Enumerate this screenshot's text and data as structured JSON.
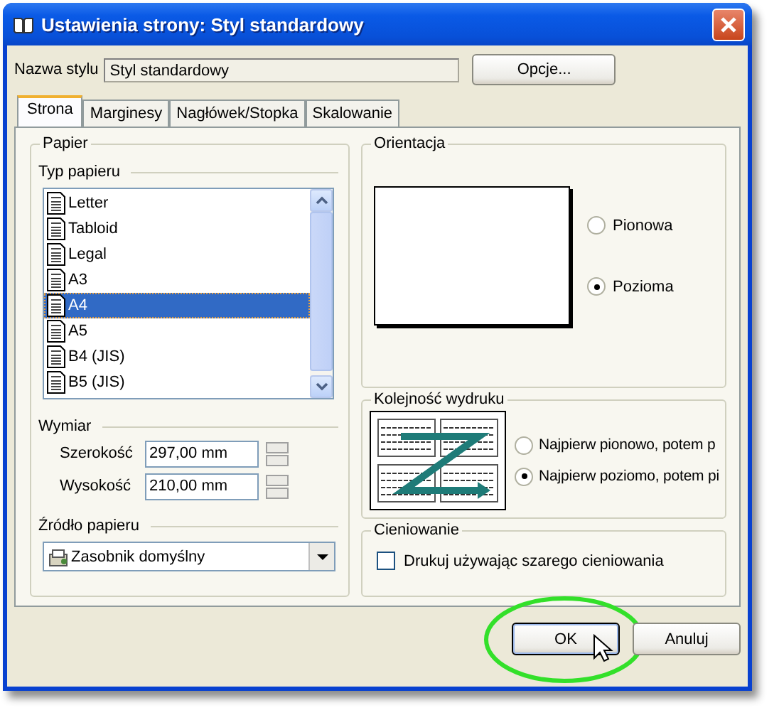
{
  "window": {
    "title": "Ustawienia strony: Styl standardowy"
  },
  "style_name": {
    "label": "Nazwa stylu",
    "value": "Styl standardowy"
  },
  "options_button": "Opcje...",
  "tabs": [
    {
      "label": "Strona",
      "selected": true
    },
    {
      "label": "Marginesy",
      "selected": false
    },
    {
      "label": "Nagłówek/Stopka",
      "selected": false
    },
    {
      "label": "Skalowanie",
      "selected": false
    }
  ],
  "paper": {
    "title": "Papier",
    "type_label": "Typ papieru",
    "sizes": [
      {
        "label": "Letter",
        "selected": false
      },
      {
        "label": "Tabloid",
        "selected": false
      },
      {
        "label": "Legal",
        "selected": false
      },
      {
        "label": "A3",
        "selected": false
      },
      {
        "label": "A4",
        "selected": true
      },
      {
        "label": "A5",
        "selected": false
      },
      {
        "label": "B4 (JIS)",
        "selected": false
      },
      {
        "label": "B5 (JIS)",
        "selected": false
      }
    ],
    "dimensions": {
      "title": "Wymiar",
      "fields": [
        {
          "label": "Szerokość",
          "value": "297,00 mm"
        },
        {
          "label": "Wysokość",
          "value": "210,00 mm"
        }
      ]
    },
    "source": {
      "label": "Źródło papieru",
      "value": "Zasobnik domyślny"
    }
  },
  "orientation": {
    "title": "Orientacja",
    "options": [
      {
        "label": "Pionowa",
        "selected": false
      },
      {
        "label": "Pozioma",
        "selected": true
      }
    ]
  },
  "print_order": {
    "title": "Kolejność wydruku",
    "options": [
      {
        "label": "Najpierw pionowo, potem p",
        "selected": false
      },
      {
        "label": "Najpierw poziomo, potem pi",
        "selected": true
      }
    ]
  },
  "shading": {
    "title": "Cieniowanie",
    "checkbox": {
      "label": "Drukuj używając szarego cieniowania",
      "checked": false
    }
  },
  "buttons": [
    {
      "label": "OK",
      "highlighted": true
    },
    {
      "label": "Anuluj",
      "highlighted": false
    }
  ]
}
